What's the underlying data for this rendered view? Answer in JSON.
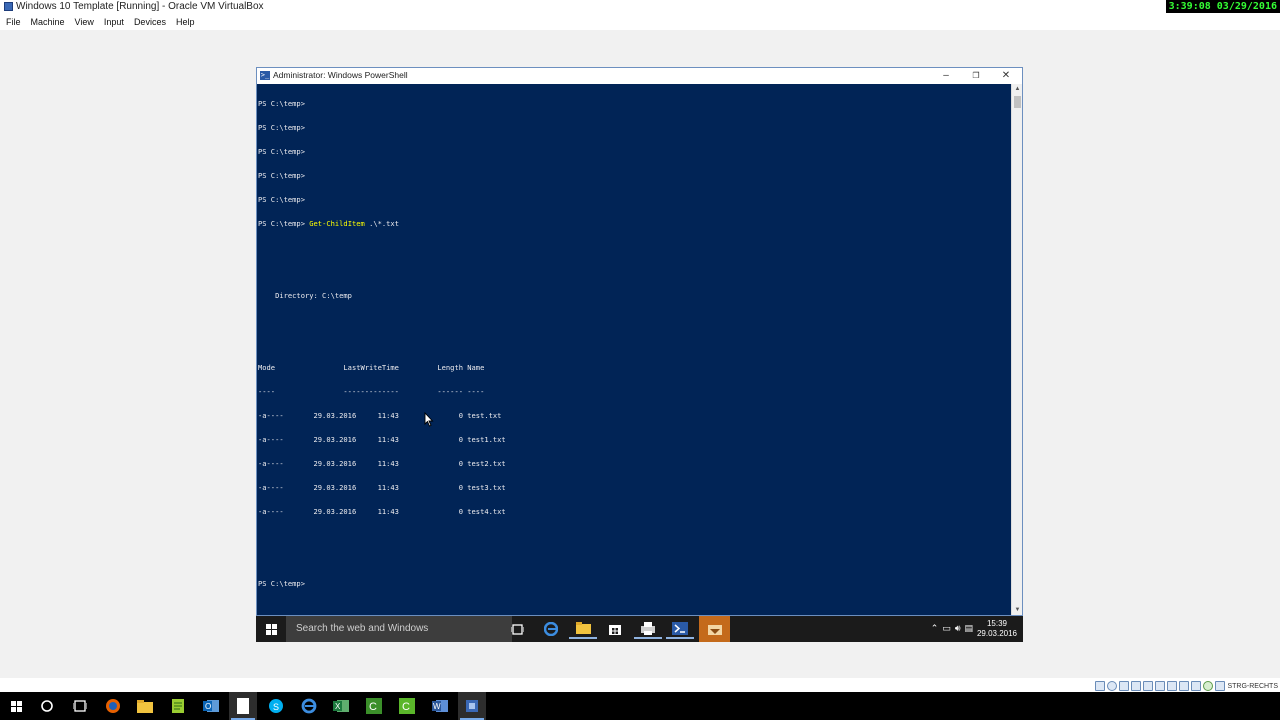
{
  "host": {
    "window_title": "Windows 10 Template [Running] - Oracle VM VirtualBox",
    "clock_overlay": "3:39:08 03/29/2016",
    "menu": [
      "File",
      "Machine",
      "View",
      "Input",
      "Devices",
      "Help"
    ],
    "host_key_label": "STRG-RECHTS"
  },
  "powershell": {
    "title": "Administrator: Windows PowerShell",
    "prompt": "PS C:\\temp>",
    "command": "Get-ChildItem",
    "command_args": " .\\*.txt",
    "directory_label": "    Directory: C:\\temp",
    "header": "Mode                LastWriteTime         Length Name",
    "underline": "----                -------------         ------ ----",
    "rows": [
      "-a----       29.03.2016     11:43              0 test.txt",
      "-a----       29.03.2016     11:43              0 test1.txt",
      "-a----       29.03.2016     11:43              0 test2.txt",
      "-a----       29.03.2016     11:43              0 test3.txt",
      "-a----       29.03.2016     11:43              0 test4.txt"
    ]
  },
  "guest_taskbar": {
    "search_placeholder": "Search the web and Windows",
    "time": "15:39",
    "date": "29.03.2016",
    "icons": [
      "task-view-icon",
      "edge-icon",
      "file-explorer-icon",
      "store-icon",
      "printer-icon",
      "powershell-icon",
      "app-icon"
    ]
  },
  "host_taskbar": {
    "icons": [
      "windows-start-icon",
      "cortana-icon",
      "task-view-icon",
      "firefox-icon",
      "file-explorer-icon",
      "notepad-plus-icon",
      "outlook-icon",
      "notepad-icon",
      "skype-icon",
      "edge-icon",
      "excel-icon",
      "camtasia-icon",
      "camtasia-recorder-icon",
      "word-icon",
      "virtualbox-icon"
    ]
  },
  "colors": {
    "ps_background": "#012456",
    "ps_text": "#eeedf0",
    "ps_command": "#ffff00",
    "clock_text": "#35ff35"
  }
}
